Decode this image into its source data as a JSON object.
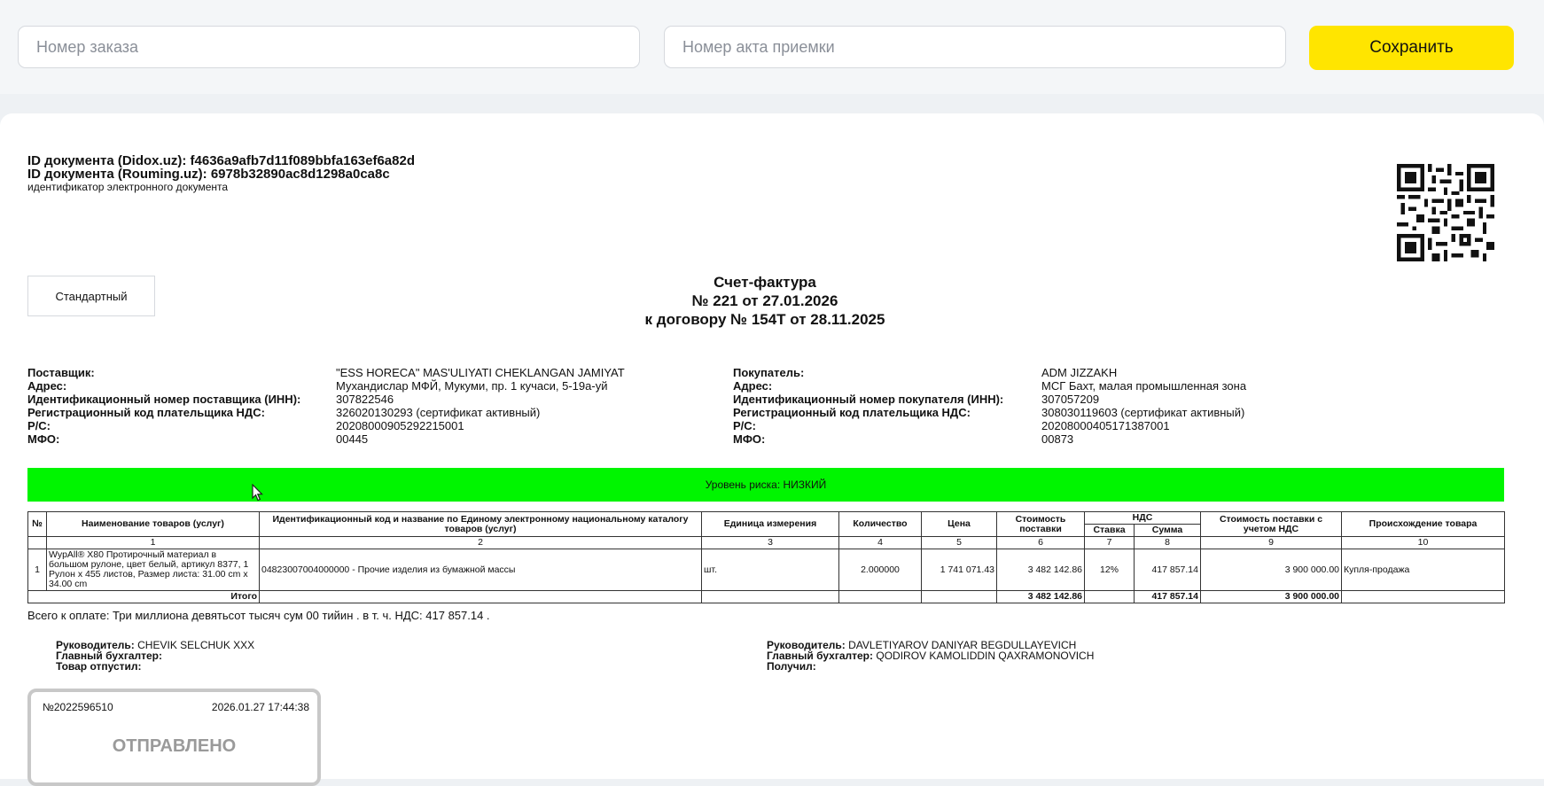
{
  "form": {
    "order_placeholder": "Номер заказа",
    "act_placeholder": "Номер акта приемки",
    "save_label": "Сохранить"
  },
  "doc": {
    "didox_id": "ID документа (Didox.uz): f4636a9afb7d11f089bbfa163ef6a82d",
    "rouming_id": "ID документа (Rouming.uz): 6978b32890ac8d1298a0ca8c",
    "id_caption": "идентификатор электронного документа",
    "type": "Стандартный",
    "title": "Счет-фактура",
    "number_line": "№ 221 от 27.01.2026",
    "contract_line": "к договору № 154T от 28.11.2025"
  },
  "supplier": {
    "labels": [
      "Поставщик:",
      "Адрес:",
      "Идентификационный номер поставщика  (ИНН):",
      "Регистрационный код плательщика НДС:",
      "Р/С:",
      "МФО:"
    ],
    "values": [
      "\"ESS HORECA\" MAS'ULIYATI CHEKLANGAN JAMIYAT",
      "Мухандислар МФЙ, Мукуми, пр. 1 кучаси, 5-19а-уй",
      "307822546",
      "326020130293 (сертификат активный)",
      "20208000905292215001",
      "00445"
    ]
  },
  "buyer": {
    "labels": [
      "Покупатель:",
      "Адрес:",
      "Идентификационный номер покупателя (ИНН):",
      "Регистрационный код плательщика НДС:",
      "Р/С:",
      "МФО:"
    ],
    "values": [
      "ADM JIZZAKH",
      "МСГ Бахт, малая промышленная зона",
      "307057209",
      "308030119603 (сертификат активный)",
      "20208000405171387001",
      "00873"
    ]
  },
  "risk": {
    "label": "Уровень риска: НИЗКИЙ",
    "color": "#00f500"
  },
  "table": {
    "h_no": "№",
    "h_name": "Наименование товаров (услуг)",
    "h_code": "Идентификационный код и название по Единому электронному национальному каталогу товаров (услуг)",
    "h_unit": "Единица измерения",
    "h_qty": "Количество",
    "h_price": "Цена",
    "h_cost": "Стоимость поставки",
    "h_vat": "НДС",
    "h_rate": "Ставка",
    "h_sum": "Сумма",
    "h_total": "Стоимость поставки с учетом НДС",
    "h_origin": "Происхождение товара",
    "col_numbers": [
      "1",
      "2",
      "3",
      "4",
      "5",
      "6",
      "7",
      "8",
      "9",
      "10"
    ],
    "row": {
      "no": "1",
      "name": "WypAll® X80 Протирочный материал в большом рулоне, цвет белый, артикул 8377, 1 Рулон x 455 листов, Размер листа: 31.00 cm x 34.00 cm",
      "code": "04823007004000000 - Прочие изделия из бумажной массы",
      "unit": "шт.",
      "qty": "2.000000",
      "price": "1 741 071.43",
      "cost": "3 482 142.86",
      "rate": "12%",
      "sum": "417 857.14",
      "total": "3 900 000.00",
      "origin": "Купля-продажа"
    },
    "itogo_label": "Итого",
    "itogo_cost": "3 482 142.86",
    "itogo_sum": "417 857.14",
    "itogo_total": "3 900 000.00"
  },
  "total_words": "Всего к оплате: Три миллиона девятьсот тысяч сум 00 тийин . в т. ч. НДС: 417 857.14 .",
  "sign_left": {
    "head_label": "Руководитель:",
    "head": "CHEVIK SELCHUK XXX",
    "acc_label": "Главный бухгалтер:",
    "acc": "",
    "out_label": "Товар отпустил:",
    "out": ""
  },
  "sign_right": {
    "head_label": "Руководитель:",
    "head": "DAVLETIYAROV DANIYAR BEGDULLAYEVICH",
    "acc_label": "Главный бухгалтер:",
    "acc": "QODIROV KAMOLIDDIN QAXRAMONOVICH",
    "got_label": "Получил:",
    "got": ""
  },
  "stamp": {
    "number": "№2022596510",
    "datetime": "2026.01.27 17:44:38",
    "status": "ОТПРАВЛЕНО"
  }
}
